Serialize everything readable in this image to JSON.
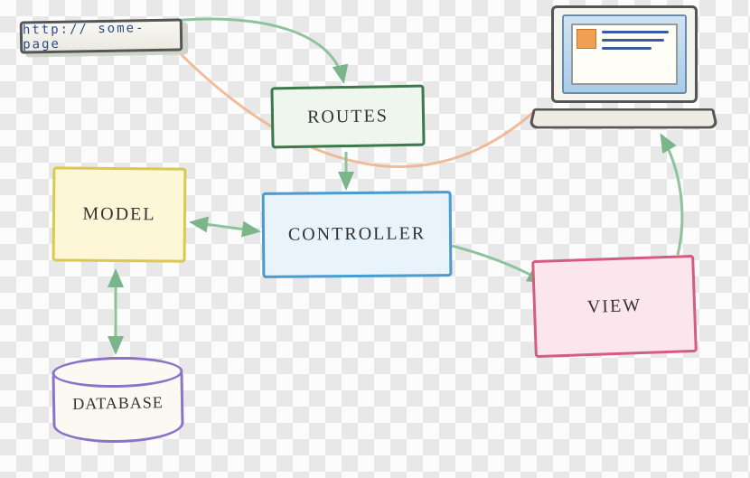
{
  "url_bar": {
    "text": "http:// some-page"
  },
  "boxes": {
    "routes": {
      "label": "ROUTES"
    },
    "controller": {
      "label": "CONTROLLER"
    },
    "model": {
      "label": "MODEL"
    },
    "view": {
      "label": "VIEW"
    },
    "database": {
      "label": "DATABASE"
    }
  },
  "browser_window": {
    "type": "laptop-browser-mock"
  },
  "flow": {
    "description": "MVC request flow: URL → Routes → Controller; Controller ↔ Model; Model ↔ Database; Controller → View; View → rendered page (laptop)",
    "arrows": [
      {
        "from": "url-bar",
        "to": "routes",
        "color": "green",
        "bidirectional": false
      },
      {
        "from": "routes",
        "to": "controller",
        "color": "green",
        "bidirectional": false
      },
      {
        "from": "controller",
        "to": "model",
        "color": "green",
        "bidirectional": true
      },
      {
        "from": "model",
        "to": "database",
        "color": "green",
        "bidirectional": true
      },
      {
        "from": "controller",
        "to": "view",
        "color": "green",
        "bidirectional": false
      },
      {
        "from": "view",
        "to": "laptop",
        "color": "green",
        "bidirectional": false
      },
      {
        "from": "laptop",
        "to": "url-bar",
        "color": "orange",
        "bidirectional": false,
        "note": "response/render path"
      }
    ]
  }
}
